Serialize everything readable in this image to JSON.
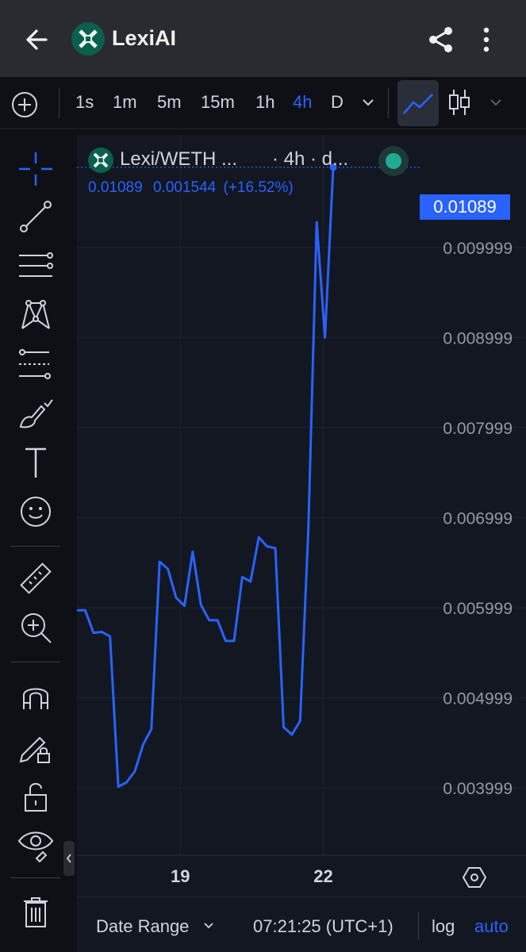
{
  "app": {
    "title": "LexiAI",
    "icons": [
      "back-arrow-icon",
      "lexi-logo-icon",
      "share-icon",
      "more-vert-icon"
    ]
  },
  "toolbar": {
    "timeframes": [
      "1s",
      "1m",
      "5m",
      "15m",
      "1h",
      "4h",
      "D"
    ],
    "active_timeframe": "4h",
    "active_chart_style": "line",
    "colors": {
      "active": "#2962ff"
    }
  },
  "drawing_tools": [
    "crosshair-icon",
    "trend-line-icon",
    "parallel-channel-icon",
    "pattern-icon",
    "fib-retracement-icon",
    "brush-icon",
    "text-icon",
    "emoji-icon",
    "ruler-icon",
    "zoom-in-icon",
    "magnet-icon",
    "lock-drawing-icon",
    "unlock-icon",
    "eye-icon",
    "trash-icon"
  ],
  "legend": {
    "symbol": "Lexi/WETH ...",
    "interval": "· 4h · d...",
    "last": "0.01089",
    "change": "0.001544",
    "change_pct": "(+16.52%)",
    "status_color": "#22ab94"
  },
  "price_tag": "0.01089",
  "bottom": {
    "date_range": "Date Range",
    "time": "07:21:25 (UTC+1)",
    "log": "log",
    "auto": "auto"
  },
  "chart_data": {
    "type": "line",
    "series": [
      {
        "values": [
          0.00597,
          0.00597,
          0.00572,
          0.00573,
          0.00568,
          0.00401,
          0.00406,
          0.00418,
          0.00448,
          0.00465,
          0.00651,
          0.00643,
          0.00611,
          0.00602,
          0.00662,
          0.00603,
          0.00586,
          0.00586,
          0.00563,
          0.00563,
          0.00634,
          0.00629,
          0.00678,
          0.00668,
          0.00666,
          0.00467,
          0.00459,
          0.00474,
          0.00688,
          0.01028,
          0.009,
          0.01089
        ]
      }
    ],
    "x_tick_labels": [
      "19",
      "22"
    ],
    "x_tick_index": [
      12.5,
      29.8
    ],
    "y_ticks": [
      0.003999,
      0.004999,
      0.005999,
      0.006999,
      0.007999,
      0.008999,
      0.009999
    ],
    "y_tick_labels": [
      "0.003999",
      "0.004999",
      "0.005999",
      "0.006999",
      "0.007999",
      "0.008999",
      "0.009999"
    ],
    "ylim": [
      0.00325,
      0.01125
    ],
    "last_value": 0.01089,
    "line_color": "#2962ff",
    "grid": true
  }
}
